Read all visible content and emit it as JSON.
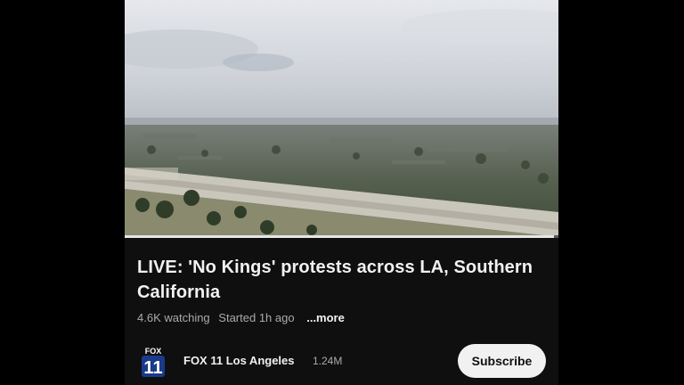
{
  "video": {
    "title": "LIVE: 'No Kings' protests across LA, Southern California",
    "progress": 0.99
  },
  "meta": {
    "watching": "4.6K watching",
    "started": "Started 1h ago",
    "more": "...more"
  },
  "channel": {
    "logo_top": "FOX",
    "logo_number": "11",
    "name": "FOX 11 Los Angeles",
    "subscribers": "1.24M"
  },
  "actions": {
    "subscribe_label": "Subscribe"
  },
  "colors": {
    "background": "#0f0f0f",
    "text_primary": "#f1f1f1",
    "text_secondary": "#aaaaaa",
    "subscribe_bg": "#f1f1f1",
    "fox_blue": "#1a3a8a"
  }
}
